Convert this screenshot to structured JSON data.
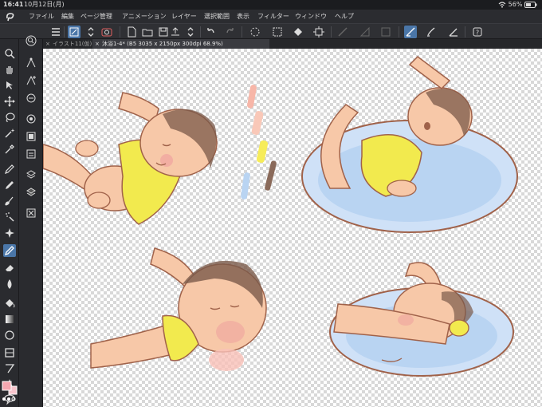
{
  "status_bar": {
    "time": "16:41",
    "date": "10月12日(月)",
    "battery": "56%"
  },
  "menu": {
    "items": [
      {
        "label": "ファイル"
      },
      {
        "label": "編集"
      },
      {
        "label": "ページ管理"
      },
      {
        "label": "アニメーション"
      },
      {
        "label": "レイヤー"
      },
      {
        "label": "選択範囲"
      },
      {
        "label": "表示"
      },
      {
        "label": "フィルター"
      },
      {
        "label": "ウィンドウ"
      },
      {
        "label": "ヘルプ"
      }
    ]
  },
  "tabs": [
    {
      "label": "イラスト11(仮)",
      "active": false
    },
    {
      "label": "沐浴1-4* (B5 3035 x 2150px 300dpi 68.9%)",
      "active": true
    }
  ],
  "colors": {
    "ui_bg": "#2b2c30",
    "accent": "#4a76a8",
    "main_color": "#f4a7b0",
    "sub_color": "#f7c4cc",
    "skin": "#f7c8a8",
    "skin_shadow": "#f0a8a0",
    "towel": "#f2ea4e",
    "water": "#a9c8ee",
    "line": "#a0624a"
  },
  "icons": {
    "toolbar": [
      "menu-icon",
      "canvas-icon",
      "chevron-up-down-icon",
      "camera-icon",
      "new-file-icon",
      "open-folder-icon",
      "save-icon",
      "export-icon",
      "undo-icon",
      "redo-icon",
      "loading-icon",
      "clear-icon",
      "fill-icon",
      "transform-icon",
      "snap-ruler-icon",
      "snap-special-ruler-icon",
      "snap-grid-icon",
      "pen-pressure-icon",
      "brush-icon",
      "stabilizer-icon",
      "help-icon"
    ],
    "tools": [
      "zoom-icon",
      "hand-icon",
      "operation-icon",
      "move-icon",
      "lasso-icon",
      "wand-icon",
      "eyedropper-icon",
      "pen-icon",
      "pencil-icon",
      "brush-icon",
      "airbrush-icon",
      "decoration-icon",
      "eraser-icon",
      "blend-icon",
      "fill-icon",
      "gradient-icon",
      "shape-icon",
      "frame-icon",
      "text-icon",
      "balloon-icon",
      "line-correction-icon"
    ]
  }
}
